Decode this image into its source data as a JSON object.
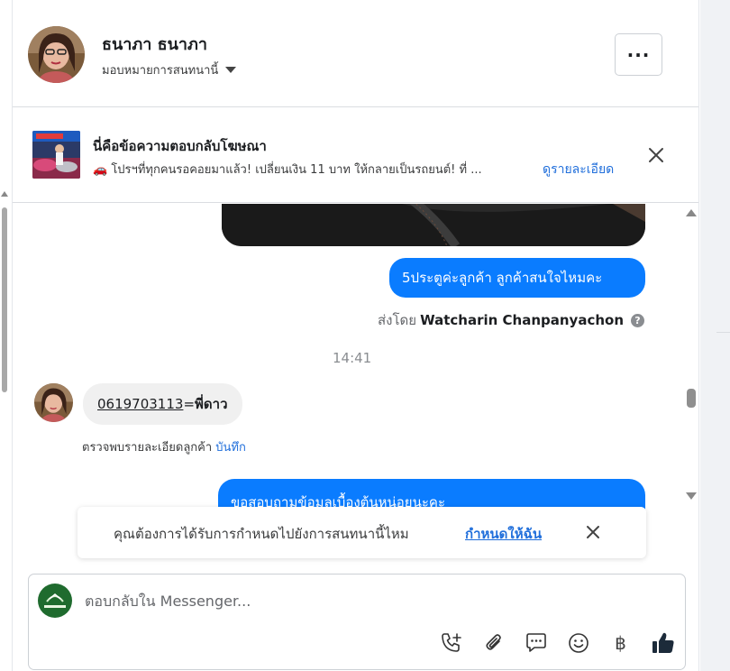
{
  "header": {
    "contact_name": "ธนาภา ธนาภา",
    "assign_label": "มอบหมายการสนทนานี้",
    "more_label": "···"
  },
  "ad": {
    "title": "นี่คือข้อความตอบกลับโฆษณา",
    "description": "🚗 โปรฯที่ทุกคนรอคอยมาแล้ว! เปลี่ยนเงิน 11 บาท ให้กลายเป็นรถยนต์! ที่ ...",
    "details_link": "ดูรายละเอียด"
  },
  "chat": {
    "outgoing_1": "5ประตูค่ะลูกค้า ลูกค้าสนใจไหมคะ",
    "sent_by_prefix": "ส่งโดย",
    "sent_by_name": "Watcharin Chanpanyachon",
    "time": "14:41",
    "incoming_phone": "0619703113",
    "incoming_separator": "=",
    "incoming_name": "พี่ดาว",
    "note_text": "ตรวจพบรายละเอียดลูกค้า",
    "note_save": "บันทึก",
    "outgoing_2": "ขอสอบถามข้อมูลเบื้องต้นหน่อยนะคะ"
  },
  "toast": {
    "text": "คุณต้องการได้รับการกำหนดไปยังการสนทนานี้ไหม",
    "link": "กำหนดให้ฉัน"
  },
  "composer": {
    "placeholder": "ตอบกลับใน Messenger...",
    "baht_symbol": "฿"
  },
  "icons": [
    "chevron-down-icon",
    "more-icon",
    "close-icon",
    "help-icon",
    "call-add-icon",
    "paperclip-icon",
    "chat-bubble-icon",
    "emoji-icon",
    "baht-icon",
    "thumbs-up-icon"
  ],
  "colors": {
    "accent": "#0a7cff",
    "link": "#216fdb",
    "incoming_bubble": "#f0f0f0"
  }
}
